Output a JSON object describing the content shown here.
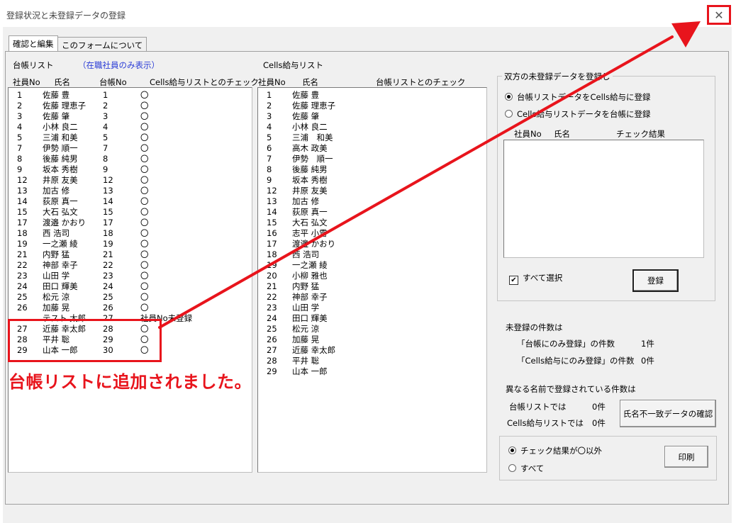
{
  "window": {
    "title": "登録状況と未登録データの登録",
    "close_symbol": "✕"
  },
  "tabs": [
    {
      "label": "確認と編集",
      "active": true
    },
    {
      "label": "このフォームについて",
      "active": false
    }
  ],
  "left_list": {
    "title": "台帳リスト",
    "filter_note": "（在職社員のみ表示）",
    "headers": [
      "社員No",
      "氏名",
      "台帳No",
      "Cells給与リストとのチェック"
    ],
    "rows": [
      [
        "1",
        "佐藤 豊",
        "1",
        "〇"
      ],
      [
        "2",
        "佐藤 理恵子",
        "2",
        "〇"
      ],
      [
        "3",
        "佐藤 肇",
        "3",
        "〇"
      ],
      [
        "4",
        "小林 良二",
        "4",
        "〇"
      ],
      [
        "5",
        "三浦 和美",
        "5",
        "〇"
      ],
      [
        "7",
        "伊勢 順一",
        "7",
        "〇"
      ],
      [
        "8",
        "後藤 純男",
        "8",
        "〇"
      ],
      [
        "9",
        "坂本 秀樹",
        "9",
        "〇"
      ],
      [
        "12",
        "井原 友美",
        "12",
        "〇"
      ],
      [
        "13",
        "加古 修",
        "13",
        "〇"
      ],
      [
        "14",
        "荻原 真一",
        "14",
        "〇"
      ],
      [
        "15",
        "大石 弘文",
        "15",
        "〇"
      ],
      [
        "17",
        "渡邉 かおり",
        "17",
        "〇"
      ],
      [
        "18",
        "西 浩司",
        "18",
        "〇"
      ],
      [
        "19",
        "一之瀬 綾",
        "19",
        "〇"
      ],
      [
        "21",
        "内野 猛",
        "21",
        "〇"
      ],
      [
        "22",
        "神部 幸子",
        "22",
        "〇"
      ],
      [
        "23",
        "山田 学",
        "23",
        "〇"
      ],
      [
        "24",
        "田口 輝美",
        "24",
        "〇"
      ],
      [
        "25",
        "松元 涼",
        "25",
        "〇"
      ],
      [
        "26",
        "加藤 晃",
        "26",
        "〇"
      ],
      [
        "",
        "テスト 太郎",
        "27",
        "社員No未登録"
      ],
      [
        "27",
        "近藤 幸太郎",
        "28",
        "〇"
      ],
      [
        "28",
        "平井 聡",
        "29",
        "〇"
      ],
      [
        "29",
        "山本 一郎",
        "30",
        "〇"
      ]
    ]
  },
  "right_list": {
    "title": "Cells給与リスト",
    "headers": [
      "社員No",
      "氏名",
      "台帳リストとのチェック"
    ],
    "rows": [
      [
        "1",
        "佐藤 豊"
      ],
      [
        "2",
        "佐藤 理恵子"
      ],
      [
        "3",
        "佐藤 肇"
      ],
      [
        "4",
        "小林 良二"
      ],
      [
        "5",
        "三浦　和美"
      ],
      [
        "6",
        "高木 政美"
      ],
      [
        "7",
        "伊勢　順一"
      ],
      [
        "8",
        "後藤 純男"
      ],
      [
        "9",
        "坂本 秀樹"
      ],
      [
        "12",
        "井原 友美"
      ],
      [
        "13",
        "加古 修"
      ],
      [
        "14",
        "荻原 真一"
      ],
      [
        "15",
        "大石 弘文"
      ],
      [
        "16",
        "志平 小雪"
      ],
      [
        "17",
        "渡邉 かおり"
      ],
      [
        "18",
        "西 浩司"
      ],
      [
        "19",
        "一之瀬 綾"
      ],
      [
        "20",
        "小柳 雅也"
      ],
      [
        "21",
        "内野 猛"
      ],
      [
        "22",
        "神部 幸子"
      ],
      [
        "23",
        "山田 学"
      ],
      [
        "24",
        "田口 輝美"
      ],
      [
        "25",
        "松元 涼"
      ],
      [
        "26",
        "加藤 晃"
      ],
      [
        "27",
        "近藤 幸太郎"
      ],
      [
        "28",
        "平井 聡"
      ],
      [
        "29",
        "山本 一郎"
      ]
    ]
  },
  "register_group": {
    "title": "双方の未登録データを登録し",
    "option1": "台帳リストデータをCells給与に登録",
    "option2": "Cells給与リストデータを台帳に登録",
    "headers": [
      "社員No",
      "氏名",
      "チェック結果"
    ],
    "select_all_label": "すべて選択",
    "register_button": "登録"
  },
  "unregistered": {
    "heading": "未登録の件数は",
    "daicho_only_label": "「台帳にのみ登録」の件数",
    "daicho_only_count": "1件",
    "cells_only_label": "「Cells給与にのみ登録」の件数",
    "cells_only_count": "0件"
  },
  "name_mismatch": {
    "heading": "異なる名前で登録されている件数は",
    "daicho_label": "台帳リストでは",
    "daicho_count": "0件",
    "cells_label": "Cells給与リストでは",
    "cells_count": "0件",
    "check_button": "氏名不一致データの確認"
  },
  "print_group": {
    "option1": "チェック結果が〇以外",
    "option2": "すべて",
    "print_button": "印刷"
  },
  "annotation": {
    "text": "台帳リストに追加されました。"
  },
  "colors": {
    "annotation_red": "#e8141c",
    "link_blue": "#2a3cd6"
  }
}
